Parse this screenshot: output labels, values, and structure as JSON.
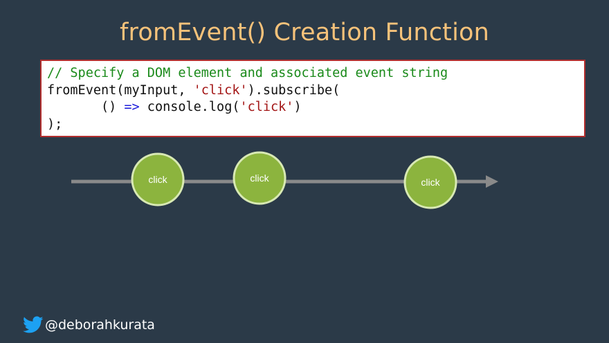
{
  "slide": {
    "title": "fromEvent() Creation Function"
  },
  "code": {
    "line1_comment": "// Specify a DOM element and associated event string",
    "line2_prefix": "fromEvent(myInput, ",
    "line2_string": "'click'",
    "line2_suffix": ").subscribe(",
    "line3_indent": "       () ",
    "line3_operator": "=>",
    "line3_middle": " console.log(",
    "line3_string": "'click'",
    "line3_suffix": ")",
    "line4": ");"
  },
  "marble_diagram": {
    "line_color": "#8a8a8a",
    "marble_fill": "#8cb43e",
    "marble_stroke": "#d8e9b4",
    "events": [
      {
        "label": "click"
      },
      {
        "label": "click"
      },
      {
        "label": "click"
      }
    ]
  },
  "footer": {
    "icon": "twitter-bird-icon",
    "handle": "@deborahkurata",
    "icon_color": "#1da1f2"
  }
}
